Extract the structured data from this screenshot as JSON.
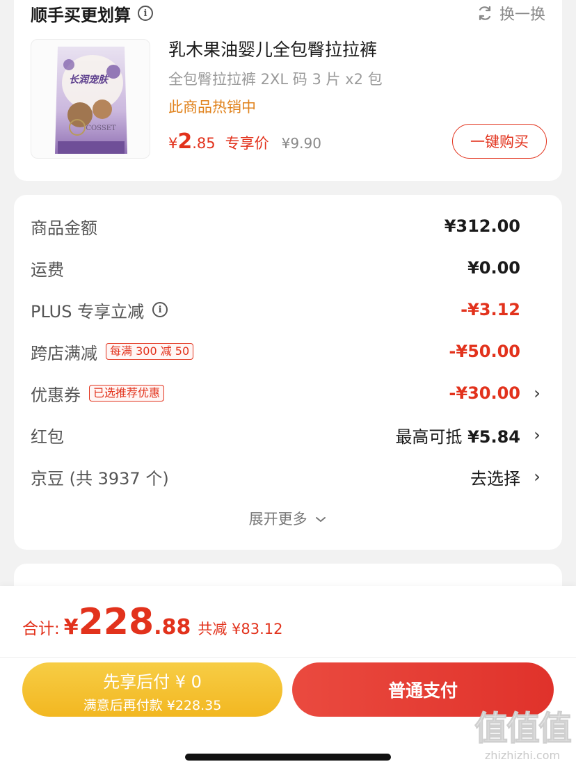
{
  "bundle_deal": {
    "title": "顺手买更划算",
    "swap_label": "换一换",
    "product": {
      "name": "乳木果油婴儿全包臀拉拉裤",
      "spec": "全包臀拉拉裤 2XL 码 3 片 x2 包",
      "hot_text": "此商品热销中",
      "price_symbol": "¥",
      "price_int": "2",
      "price_dec": ".85",
      "price_tag": "专享价",
      "original_price": "¥9.90",
      "buy_button": "一键购买",
      "package_brand_text": "长润宠肤",
      "package_cosset_text": "COSSET"
    }
  },
  "breakdown": {
    "rows": [
      {
        "label": "商品金额",
        "value": "¥312.00"
      },
      {
        "label": "运费",
        "value": "¥0.00"
      },
      {
        "label": "PLUS 专享立减",
        "value": "-¥3.12"
      },
      {
        "label": "跨店满减",
        "badge": "每满 300 减 50",
        "value": "-¥50.00"
      },
      {
        "label": "优惠券",
        "badge": "已选推荐优惠",
        "value": "-¥30.00"
      },
      {
        "label": "红包",
        "value_prefix": "最高可抵",
        "value": "¥5.84"
      },
      {
        "label": "京豆 (共 3937 个)",
        "value": "去选择"
      }
    ],
    "expand_label": "展开更多",
    "chevron": "›"
  },
  "summary": {
    "total_label": "合计:",
    "total_symbol": "¥",
    "total_int": "228",
    "total_dec": ".88",
    "savings": "共减 ¥83.12"
  },
  "actions": {
    "pay_later_main": "先享后付 ¥ 0",
    "pay_later_sub": "满意后再付款 ¥228.35",
    "pay_normal": "普通支付"
  },
  "watermark": {
    "glyphs": "值值值",
    "url": "zhizhizhi.com"
  },
  "colors": {
    "accent_red": "#e2321c",
    "hot_orange": "#e0821c",
    "pay_later_yellow": "#f2b721",
    "background": "#f2f2f2"
  }
}
